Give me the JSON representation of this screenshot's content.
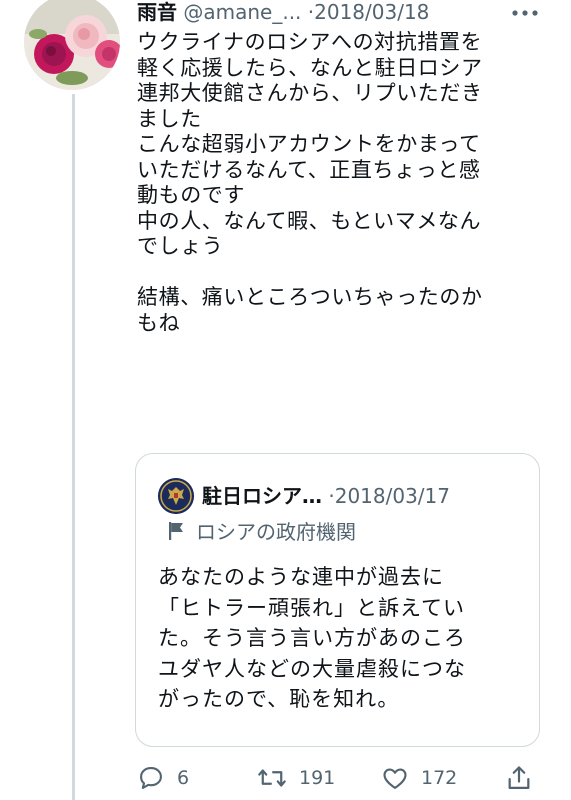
{
  "tweet": {
    "display_name": "雨音",
    "handle": "@amane_...",
    "separator": "·",
    "date": "2018/03/18",
    "more_icon": "more-dots-icon",
    "avatar_icon": "rose-avatar",
    "text": "ウクライナのロシアへの対抗措置を\n軽く応援したら、なんと駐日ロシア\n連邦大使館さんから、リプいただき\nました\nこんな超弱小アカウントをかまって\nいただけるなんて、正直ちょっと感\n動ものです\n中の人、なんて暇、もといマメなん\nでしょう\n\n結構、痛いところついちゃったのか\nもね"
  },
  "quote": {
    "avatar_icon": "russian-emblem-avatar",
    "name": "駐日ロシア…",
    "separator": "·",
    "date": "2018/03/17",
    "label_icon": "flag-icon",
    "label": "ロシアの政府機関",
    "text": "あなたのような連中が過去に\n「ヒトラー頑張れ」と訴えてい\nた。そう言う言い方があのころ\nユダヤ人などの大量虐殺につな\nがったので、恥を知れ。"
  },
  "actions": {
    "reply_count": "6",
    "retweet_count": "191",
    "like_count": "172",
    "reply_icon": "reply-icon",
    "retweet_icon": "retweet-icon",
    "like_icon": "heart-icon",
    "share_icon": "share-icon"
  },
  "colors": {
    "text": "#0f1419",
    "secondary": "#536471",
    "border": "#cfd9de"
  }
}
